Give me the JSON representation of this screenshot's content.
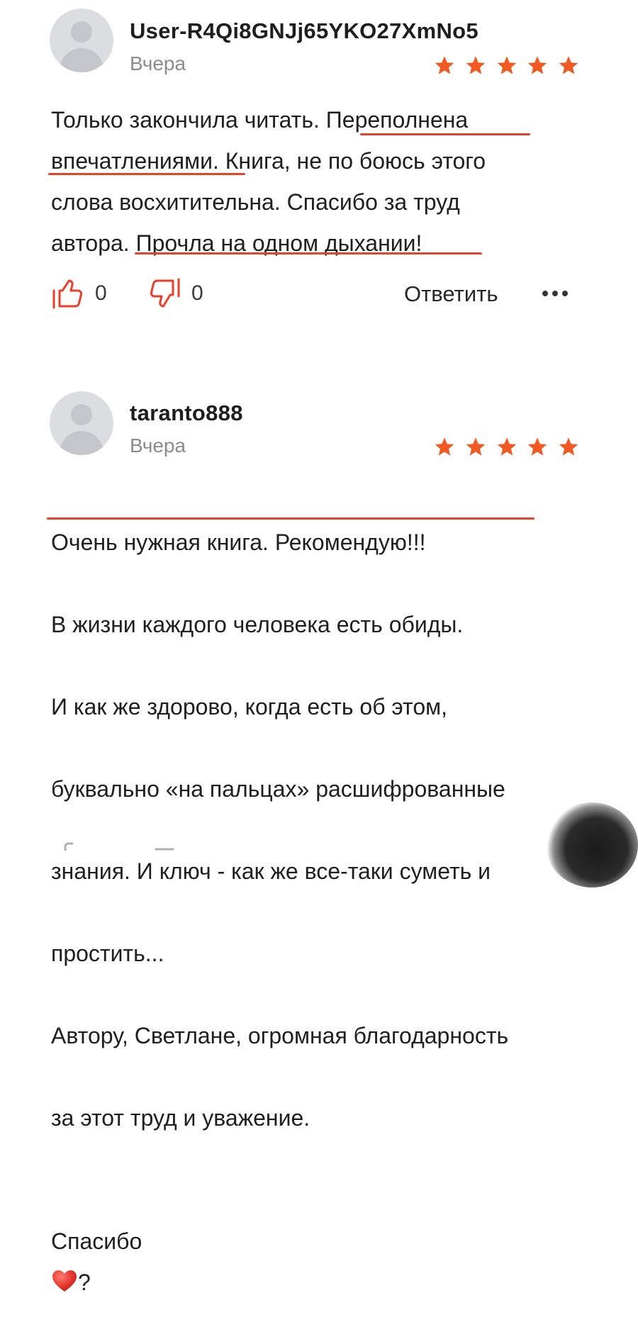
{
  "colors": {
    "accent": "#e8402a",
    "star": "#f05a22",
    "muted": "#8c8c8c"
  },
  "reviews": [
    {
      "username": "User-R4Qi8GNJj65YKO27XmNo5",
      "date": "Вчера",
      "rating": 5,
      "text": "Только закончила читать. Переполнена\nвпечатлениями. Книга, не по боюсь этого\nслова восхитительна. Спасибо за труд\nавтора. Прочла на одном дыхании!",
      "likes": "0",
      "dislikes": "0",
      "reply_label": "Ответить",
      "avatar_icon": "avatar-placeholder-icon",
      "like_icon": "thumbs-up-icon",
      "dislike_icon": "thumbs-down-icon",
      "more_icon": "more-dots-icon"
    },
    {
      "username": "taranto888",
      "date": "Вчера",
      "rating": 5,
      "text_lines": [
        "Очень нужная книга. Рекомендую!!!",
        "В жизни каждого человека есть обиды.",
        "И как же здорово, когда есть об этом,",
        "буквально «на пальцах» расшифрованные",
        "знания. И ключ - как же все-таки суметь и",
        "простить...",
        "Автору, Светлане, огромная благодарность",
        "за этот труд и уважение."
      ],
      "closing_text": "Спасибо",
      "closing_suffix": "?",
      "closing_icon": "red-heart-icon",
      "avatar_icon": "avatar-placeholder-icon"
    }
  ]
}
